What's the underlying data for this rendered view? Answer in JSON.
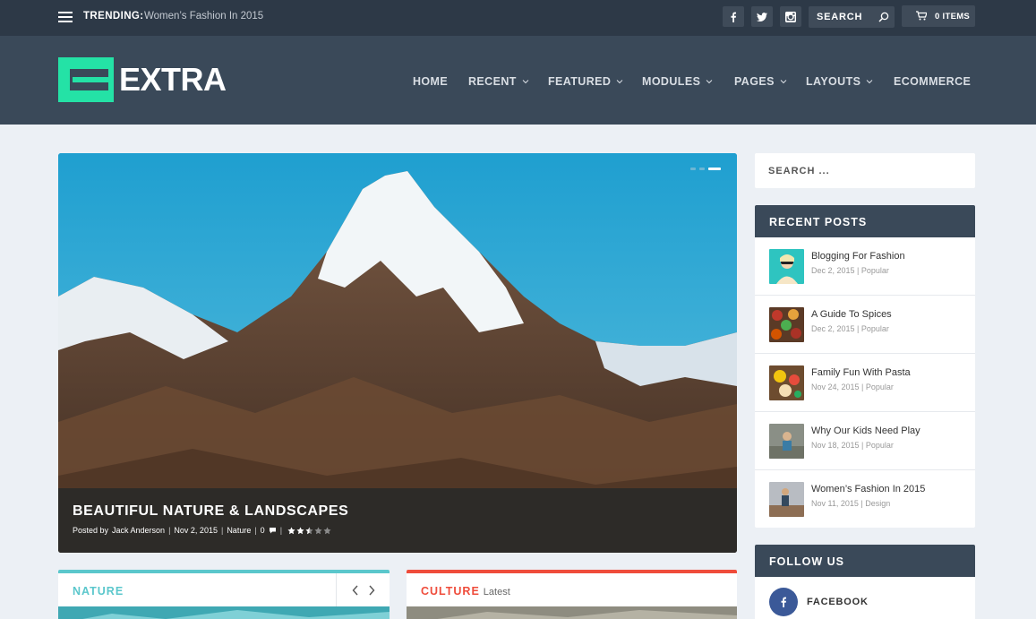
{
  "topbar": {
    "trending_label": "TRENDING:",
    "trending_title": "Women’s Fashion In 2015",
    "search_placeholder": "SEARCH",
    "cart_label": "0 ITEMS",
    "social": [
      "facebook-icon",
      "twitter-icon",
      "instagram-icon"
    ]
  },
  "brand": {
    "name": "EXTRA",
    "accent": "#24e2a6"
  },
  "nav": [
    {
      "label": "HOME",
      "dropdown": false
    },
    {
      "label": "RECENT",
      "dropdown": true
    },
    {
      "label": "FEATURED",
      "dropdown": true
    },
    {
      "label": "MODULES",
      "dropdown": true
    },
    {
      "label": "PAGES",
      "dropdown": true
    },
    {
      "label": "LAYOUTS",
      "dropdown": true
    },
    {
      "label": "ECOMMERCE",
      "dropdown": false
    }
  ],
  "hero": {
    "title": "BEAUTIFUL NATURE & LANDSCAPES",
    "author_prefix": "Posted by",
    "author": "Jack Anderson",
    "date": "Nov 2, 2015",
    "category": "Nature",
    "comments": "0",
    "rating": 2.5,
    "slides_total": 3,
    "active_slide": 3
  },
  "categories": [
    {
      "title": "NATURE",
      "subtitle": "",
      "color": "#5bc7cc"
    },
    {
      "title": "CULTURE",
      "subtitle": "Latest",
      "color": "#ef4c3b"
    }
  ],
  "sidebar": {
    "search_placeholder": "SEARCH ...",
    "recent_posts_title": "RECENT POSTS",
    "posts": [
      {
        "title": "Blogging For Fashion",
        "date": "Dec 2, 2015",
        "category": "Popular"
      },
      {
        "title": "A Guide To Spices",
        "date": "Dec 2, 2015",
        "category": "Popular"
      },
      {
        "title": "Family Fun With Pasta",
        "date": "Nov 24, 2015",
        "category": "Popular"
      },
      {
        "title": "Why Our Kids Need Play",
        "date": "Nov 18, 2015",
        "category": "Popular"
      },
      {
        "title": "Women’s Fashion In 2015",
        "date": "Nov 11, 2015",
        "category": "Design"
      }
    ],
    "follow_title": "FOLLOW US",
    "follow_items": [
      {
        "label": "FACEBOOK",
        "icon": "facebook-icon"
      }
    ]
  }
}
